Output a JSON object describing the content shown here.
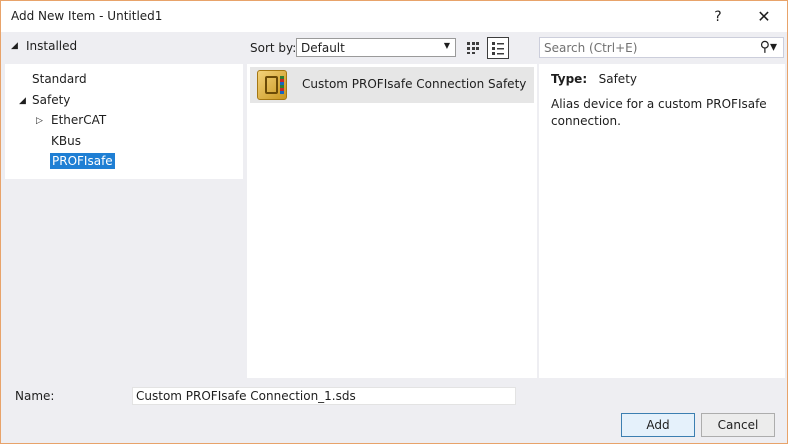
{
  "window": {
    "title": "Add New Item - Untitled1",
    "help_label": "?",
    "close_label": "✕"
  },
  "left_panel": {
    "header": "Installed",
    "tree": [
      {
        "label": "Standard"
      },
      {
        "label": "Safety",
        "expanded": true
      },
      {
        "label": "EtherCAT",
        "expanded": false
      },
      {
        "label": "KBus"
      },
      {
        "label": "PROFIsafe",
        "selected": true
      }
    ]
  },
  "toolbar": {
    "sort_label": "Sort by:",
    "sort_value": "Default",
    "search_placeholder": "Search (Ctrl+E)"
  },
  "items": [
    {
      "label": "Custom PROFIsafe Connection Safety",
      "icon": "profisafe-icon",
      "selected": true
    }
  ],
  "details": {
    "type_label": "Type:",
    "type_value": "Safety",
    "description": "Alias device for a custom PROFIsafe connection."
  },
  "footer": {
    "name_label": "Name:",
    "name_value": "Custom PROFIsafe Connection_1.sds",
    "add_label": "Add",
    "cancel_label": "Cancel"
  },
  "colors": {
    "selection": "#1f7fd4",
    "window_border": "#e8a36a",
    "dialog_bg": "#eeeef2"
  }
}
